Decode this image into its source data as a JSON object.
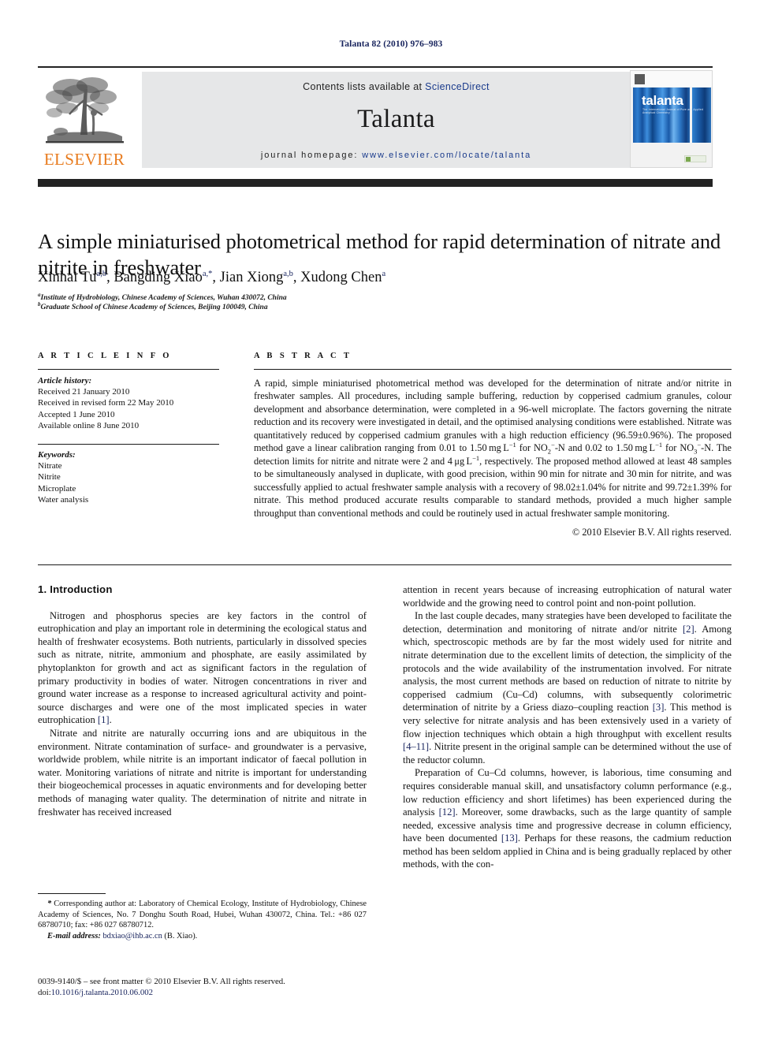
{
  "running_head": "Talanta 82 (2010) 976–983",
  "header": {
    "publisher_logo_text": "ELSEVIER",
    "contents_prefix": "Contents lists available at ",
    "contents_link": "ScienceDirect",
    "journal_name": "Talanta",
    "homepage_prefix": "journal homepage: ",
    "homepage_url": "www.elsevier.com/locate/talanta",
    "cover": {
      "title": "talanta",
      "subtitle": "The International Journal of Pure and Applied Analytical Chemistry"
    }
  },
  "article": {
    "title": "A simple miniaturised photometrical method for rapid determination of nitrate and nitrite in freshwater",
    "authors_html": "Xinhai Tu<sup>a,b</sup>, Bangding Xiao<sup>a,</sup><sup>*</sup>, Jian Xiong<sup>a,b</sup>, Xudong Chen<sup>a</sup>",
    "affiliations": [
      {
        "marker": "a",
        "text": "Institute of Hydrobiology, Chinese Academy of Sciences, Wuhan 430072, China"
      },
      {
        "marker": "b",
        "text": "Graduate School of Chinese Academy of Sciences, Beijing 100049, China"
      }
    ]
  },
  "article_info": {
    "heading": "A R T I C L E   I N F O",
    "history_label": "Article history:",
    "history": [
      "Received 21 January 2010",
      "Received in revised form 22 May 2010",
      "Accepted 1 June 2010",
      "Available online 8 June 2010"
    ],
    "keywords_label": "Keywords:",
    "keywords": [
      "Nitrate",
      "Nitrite",
      "Microplate",
      "Water analysis"
    ]
  },
  "abstract": {
    "heading": "A B S T R A C T",
    "text_html": "A rapid, simple miniaturised photometrical method was developed for the determination of nitrate and/or nitrite in freshwater samples. All procedures, including sample buffering, reduction by copperised cadmium granules, colour development and absorbance determination, were completed in a 96-well microplate. The factors governing the nitrate reduction and its recovery were investigated in detail, and the optimised analysing conditions were established. Nitrate was quantitatively reduced by copperised cadmium granules with a high reduction efficiency (96.59&#177;0.96%). The proposed method gave a linear calibration ranging from 0.01 to 1.50&#8201;mg&#8201;L<sup>&#8722;1</sup> for NO<sub>2</sub><sup>&#8722;</sup>-N and 0.02 to 1.50&#8201;mg&#8201;L<sup>&#8722;1</sup> for NO<sub>3</sub><sup>&#8722;</sup>-N. The detection limits for nitrite and nitrate were 2 and 4&#8201;&#956;g&#8201;L<sup>&#8722;1</sup>, respectively. The proposed method allowed at least 48 samples to be simultaneously analysed in duplicate, with good precision, within 90&#8201;min for nitrate and 30&#8201;min for nitrite, and was successfully applied to actual freshwater sample analysis with a recovery of 98.02&#177;1.04% for nitrite and 99.72&#177;1.39% for nitrate. This method produced accurate results comparable to standard methods, provided a much higher sample throughput than conventional methods and could be routinely used in actual freshwater sample monitoring.",
    "copyright": "© 2010 Elsevier B.V. All rights reserved."
  },
  "body": {
    "section_heading": "1. Introduction",
    "left_paragraphs_html": [
      "Nitrogen and phosphorus species are key factors in the control of eutrophication and play an important role in determining the ecological status and health of freshwater ecosystems. Both nutrients, particularly in dissolved species such as nitrate, nitrite, ammonium and phosphate, are easily assimilated by phytoplankton for growth and act as significant factors in the regulation of primary productivity in bodies of water. Nitrogen concentrations in river and ground water increase as a response to increased agricultural activity and point-source discharges and were one of the most implicated species in water eutrophication <span class=\"ref\">[1]</span>.",
      "Nitrate and nitrite are naturally occurring ions and are ubiquitous in the environment. Nitrate contamination of surface- and groundwater is a pervasive, worldwide problem, while nitrite is an important indicator of faecal pollution in water. Monitoring variations of nitrate and nitrite is important for understanding their biogeochemical processes in aquatic environments and for developing better methods of managing water quality. The determination of nitrite and nitrate in freshwater has received increased"
    ],
    "right_paragraphs_html": [
      "attention in recent years because of increasing eutrophication of natural water worldwide and the growing need to control point and non-point pollution.",
      "In the last couple decades, many strategies have been developed to facilitate the detection, determination and monitoring of nitrate and/or nitrite <span class=\"ref\">[2]</span>. Among which, spectroscopic methods are by far the most widely used for nitrite and nitrate determination due to the excellent limits of detection, the simplicity of the protocols and the wide availability of the instrumentation involved. For nitrate analysis, the most current methods are based on reduction of nitrate to nitrite by copperised cadmium (Cu–Cd) columns, with subsequently colorimetric determination of nitrite by a Griess diazo–coupling reaction <span class=\"ref\">[3]</span>. This method is very selective for nitrate analysis and has been extensively used in a variety of flow injection techniques which obtain a high throughput with excellent results <span class=\"ref\">[4–11]</span>. Nitrite present in the original sample can be determined without the use of the reductor column.",
      "Preparation of Cu–Cd columns, however, is laborious, time consuming and requires considerable manual skill, and unsatisfactory column performance (e.g., low reduction efficiency and short lifetimes) has been experienced during the analysis <span class=\"ref\">[12]</span>. Moreover, some drawbacks, such as the large quantity of sample needed, excessive analysis time and progressive decrease in column efficiency, have been documented <span class=\"ref\">[13]</span>. Perhaps for these reasons, the cadmium reduction method has been seldom applied in China and is being gradually replaced by other methods, with the con-"
    ]
  },
  "footnote": {
    "corresponding_html": "<span class=\"em\">*</span> Corresponding author at: Laboratory of Chemical Ecology, Institute of Hydrobiology, Chinese Academy of Sciences, No. 7 Donghu South Road, Hubei, Wuhan 430072, China. Tel.: +86 027 68780710; fax: +86 027 68780712.",
    "email_label": "E-mail address:",
    "email": "bdxiao@ihb.ac.cn",
    "email_suffix": "(B. Xiao).",
    "issn_line": "0039-9140/$ – see front matter © 2010 Elsevier B.V. All rights reserved.",
    "doi_label": "doi:",
    "doi": "10.1016/j.talanta.2010.06.002"
  },
  "colors": {
    "link": "#16225c",
    "elsevier_orange": "#e87b1e",
    "header_band": "#e6e7e8",
    "rule_dark": "#232323"
  }
}
